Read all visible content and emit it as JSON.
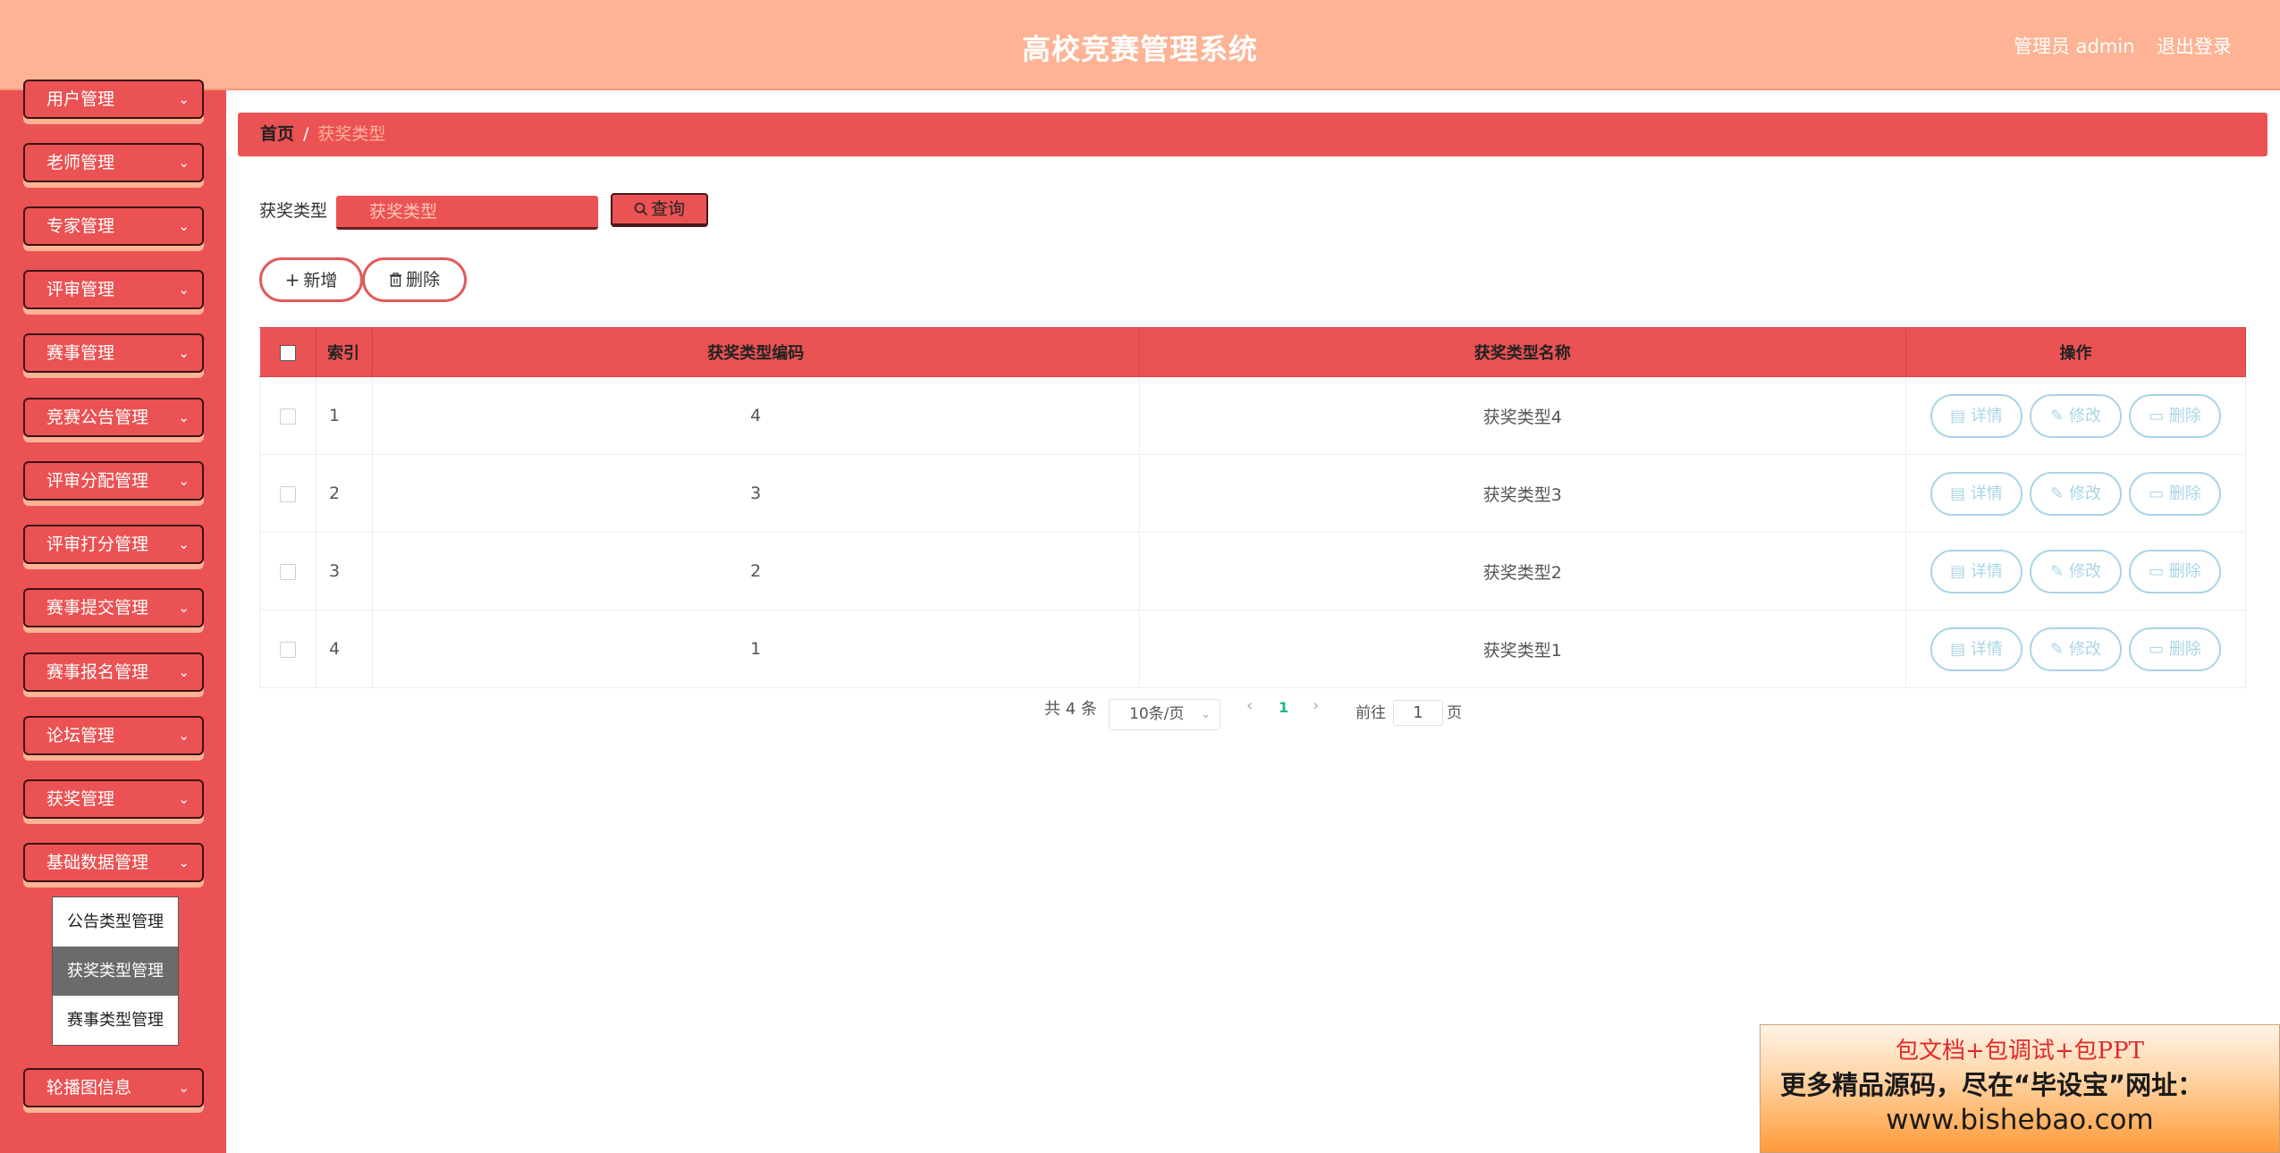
{
  "header": {
    "title": "高校竞赛管理系统",
    "user": "管理员 admin",
    "logout": "退出登录"
  },
  "sidebar": {
    "items": [
      {
        "label": "用户管理"
      },
      {
        "label": "老师管理"
      },
      {
        "label": "专家管理"
      },
      {
        "label": "评审管理"
      },
      {
        "label": "赛事管理"
      },
      {
        "label": "竞赛公告管理"
      },
      {
        "label": "评审分配管理"
      },
      {
        "label": "评审打分管理"
      },
      {
        "label": "赛事提交管理"
      },
      {
        "label": "赛事报名管理"
      },
      {
        "label": "论坛管理"
      },
      {
        "label": "获奖管理"
      },
      {
        "label": "基础数据管理"
      },
      {
        "label": "轮播图信息"
      }
    ],
    "submenu": [
      {
        "label": "公告类型管理"
      },
      {
        "label": "获奖类型管理"
      },
      {
        "label": "赛事类型管理"
      }
    ]
  },
  "breadcrumb": {
    "home": "首页",
    "sep": "/",
    "current": "获奖类型"
  },
  "search": {
    "label": "获奖类型",
    "placeholder": "获奖类型",
    "query_label": "查询"
  },
  "actions": {
    "add_label": "新增",
    "delete_label": "删除"
  },
  "table": {
    "headers": {
      "index": "索引",
      "code": "获奖类型编码",
      "name": "获奖类型名称",
      "ops": "操作"
    },
    "rows": [
      {
        "index": "1",
        "code": "4",
        "name": "获奖类型4"
      },
      {
        "index": "2",
        "code": "3",
        "name": "获奖类型3"
      },
      {
        "index": "3",
        "code": "2",
        "name": "获奖类型2"
      },
      {
        "index": "4",
        "code": "1",
        "name": "获奖类型1"
      }
    ],
    "ops": {
      "detail": "详情",
      "edit": "修改",
      "delete": "删除"
    }
  },
  "pagination": {
    "total": "共 4 条",
    "page_size": "10条/页",
    "current_page": "1",
    "goto_label": "前往",
    "goto_value": "1",
    "page_unit": "页"
  },
  "ad": {
    "line1": "包文档+包调试+包PPT",
    "line2": "更多精品源码，尽在“毕设宝”网址：",
    "line3": "www.bishebao.com"
  },
  "colors": {
    "header_bg": "#fdb394",
    "sidebar_bg": "#eb5253",
    "accent": "#eb5253",
    "op_button": "#a9d5e6",
    "pager_active": "#1fb88a"
  }
}
